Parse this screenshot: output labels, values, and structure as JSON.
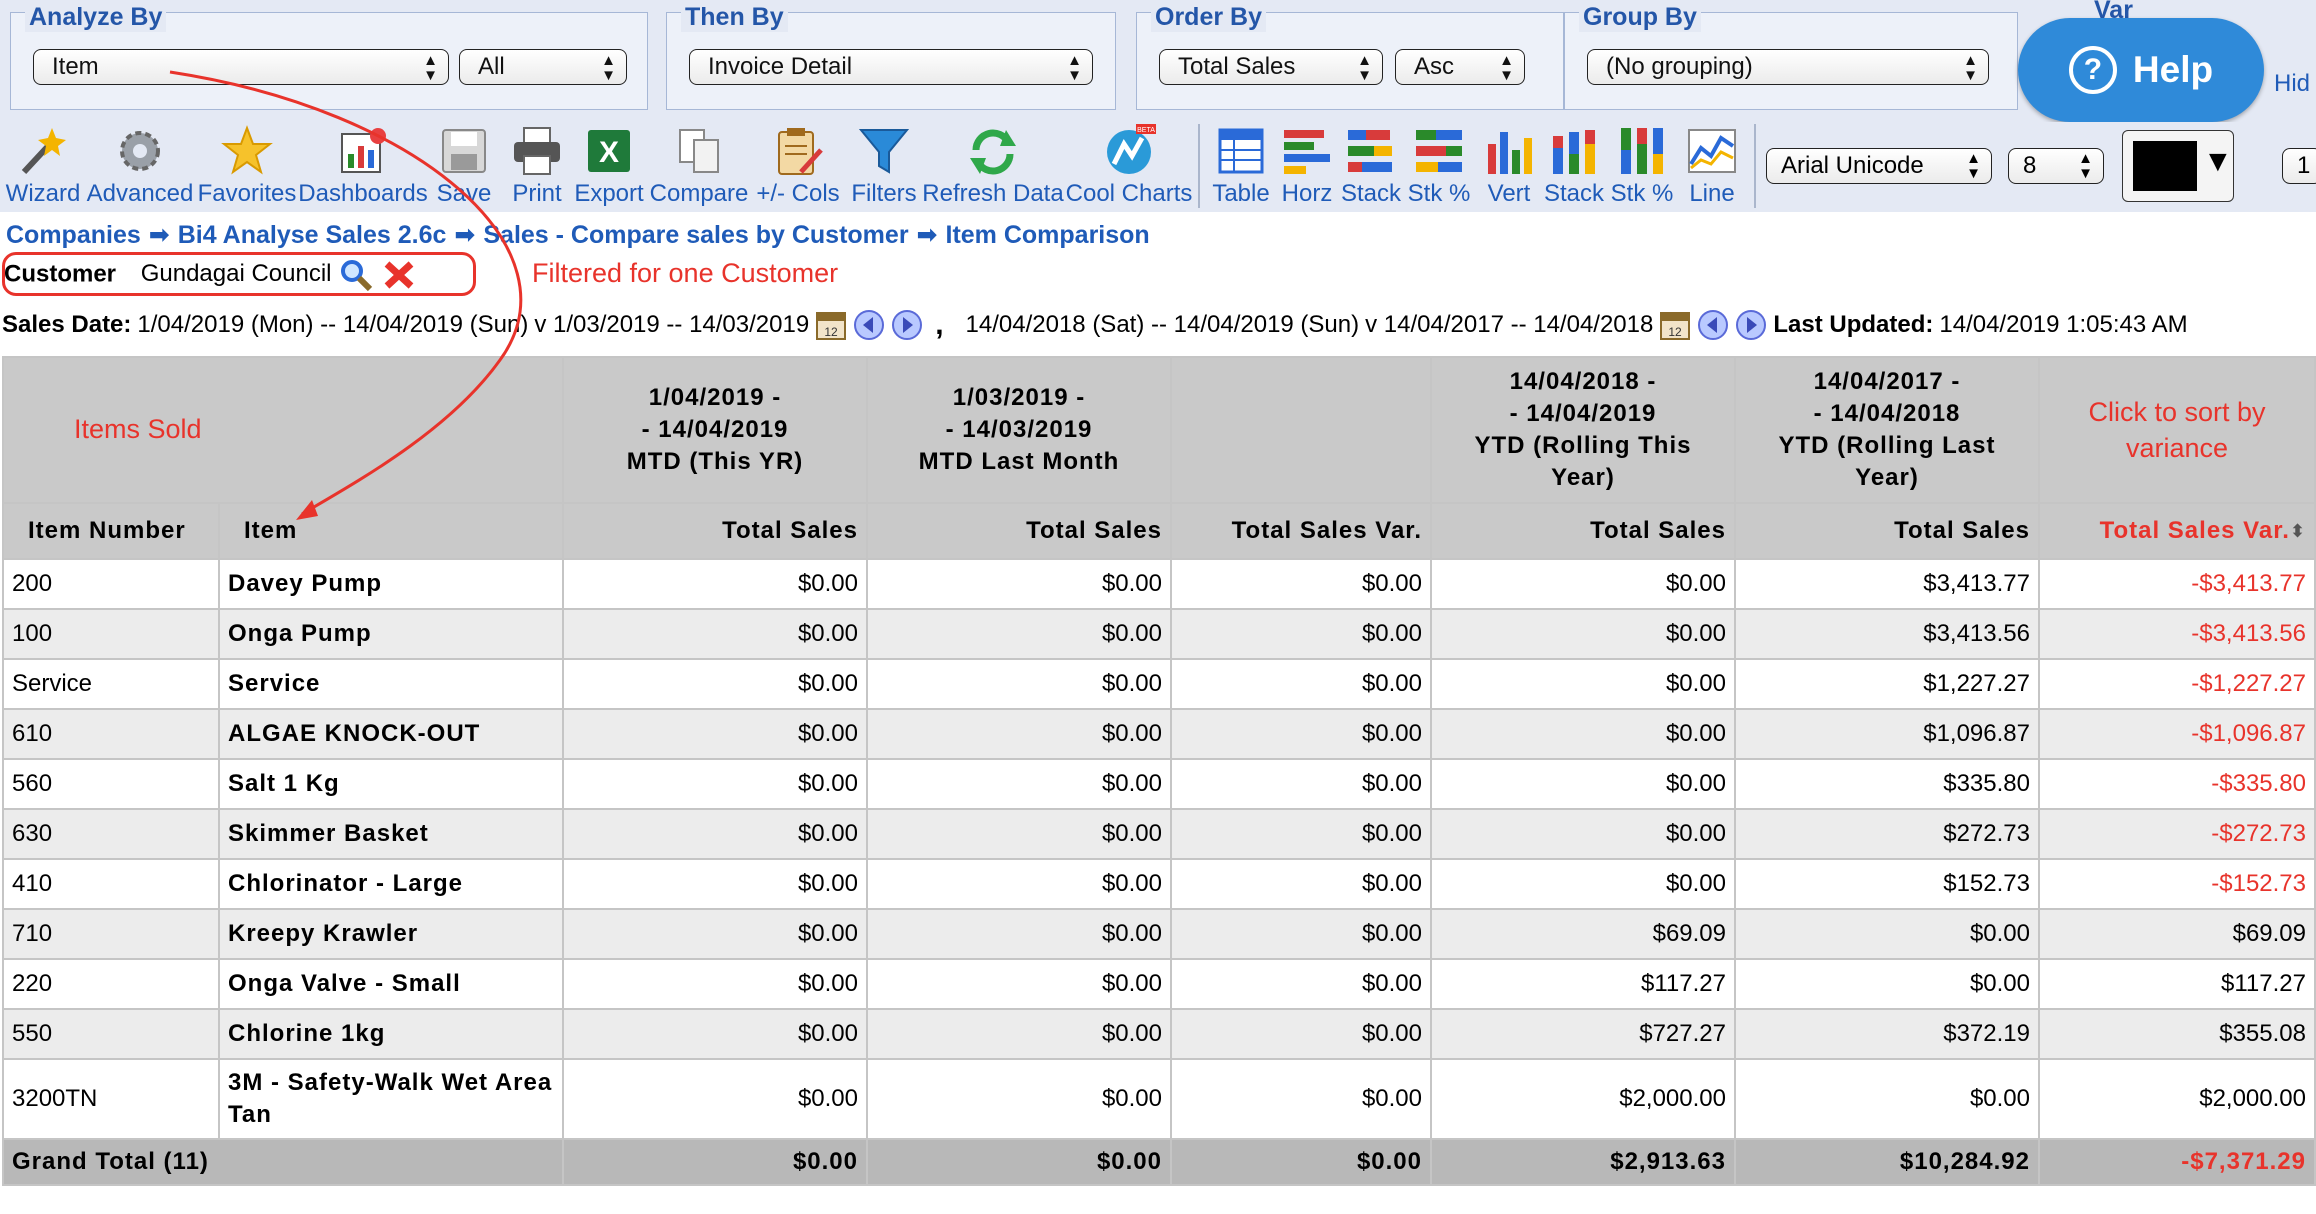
{
  "controls": {
    "analyze_by": {
      "title": "Analyze By",
      "value": "Item",
      "value2": "All"
    },
    "then_by": {
      "title": "Then By",
      "value": "Invoice Detail"
    },
    "order_by": {
      "title": "Order By",
      "value": "Total Sales",
      "direction": "Asc"
    },
    "group_by": {
      "title": "Group By",
      "value": "(No grouping)"
    },
    "var_title": "Var",
    "hide_label": "Hid",
    "help_label": "Help"
  },
  "toolbar": {
    "buttons": [
      "Wizard",
      "Advanced",
      "Favorites",
      "Dashboards",
      "Save",
      "Print",
      "Export",
      "Compare",
      "+/- Cols",
      "Filters",
      "Refresh Data",
      "Cool Charts"
    ],
    "chart_buttons": [
      "Table",
      "Horz",
      "Stack",
      "Stk %",
      "Vert",
      "Stack",
      "Stk %",
      "Line"
    ],
    "font_name": "Arial Unicode",
    "font_size": "8",
    "page_box": "1",
    "beta_badge": "BETA"
  },
  "breadcrumb": [
    "Companies",
    "Bi4 Analyse Sales 2.6c",
    "Sales - Compare sales by Customer",
    "Item Comparison"
  ],
  "filter": {
    "label": "Customer",
    "value": "Gundagai Council"
  },
  "annotations": {
    "filtered": "Filtered for one Customer",
    "items_sold": "Items Sold",
    "click_sort": "Click to sort by variance"
  },
  "dates": {
    "label": "Sales Date:",
    "range1": "1/04/2019 (Mon) -- 14/04/2019 (Sun)",
    "vs1": "v 1/03/2019 -- 14/03/2019",
    "comma": ",",
    "range2": "14/04/2018 (Sat) -- 14/04/2019 (Sun)",
    "vs2": "v 14/04/2017 -- 14/04/2018",
    "calendar_label": "12",
    "last_updated_label": "Last Updated:",
    "last_updated": "14/04/2019 1:05:43 AM"
  },
  "table": {
    "period_headers": [
      [
        "1/04/2019 -",
        "- 14/04/2019",
        "MTD (This YR)"
      ],
      [
        "1/03/2019 -",
        "- 14/03/2019",
        "MTD Last Month"
      ],
      [],
      [
        "14/04/2018 -",
        "- 14/04/2019",
        "YTD (Rolling This",
        "Year)"
      ],
      [
        "14/04/2017 -",
        "- 14/04/2018",
        "YTD (Rolling Last",
        "Year)"
      ]
    ],
    "columns": [
      "Item Number",
      "Item",
      "Total Sales",
      "Total Sales",
      "Total Sales Var.",
      "Total Sales",
      "Total Sales",
      "Total Sales Var."
    ],
    "rows": [
      {
        "num": "200",
        "item": "Davey Pump",
        "c1": "$0.00",
        "c2": "$0.00",
        "c3": "$0.00",
        "c4": "$0.00",
        "c5": "$3,413.77",
        "c6": "-$3,413.77"
      },
      {
        "num": "100",
        "item": "Onga Pump",
        "c1": "$0.00",
        "c2": "$0.00",
        "c3": "$0.00",
        "c4": "$0.00",
        "c5": "$3,413.56",
        "c6": "-$3,413.56"
      },
      {
        "num": "Service",
        "item": "Service",
        "c1": "$0.00",
        "c2": "$0.00",
        "c3": "$0.00",
        "c4": "$0.00",
        "c5": "$1,227.27",
        "c6": "-$1,227.27"
      },
      {
        "num": "610",
        "item": "ALGAE KNOCK-OUT",
        "c1": "$0.00",
        "c2": "$0.00",
        "c3": "$0.00",
        "c4": "$0.00",
        "c5": "$1,096.87",
        "c6": "-$1,096.87"
      },
      {
        "num": "560",
        "item": "Salt 1 Kg",
        "c1": "$0.00",
        "c2": "$0.00",
        "c3": "$0.00",
        "c4": "$0.00",
        "c5": "$335.80",
        "c6": "-$335.80"
      },
      {
        "num": "630",
        "item": "Skimmer Basket",
        "c1": "$0.00",
        "c2": "$0.00",
        "c3": "$0.00",
        "c4": "$0.00",
        "c5": "$272.73",
        "c6": "-$272.73"
      },
      {
        "num": "410",
        "item": "Chlorinator - Large",
        "c1": "$0.00",
        "c2": "$0.00",
        "c3": "$0.00",
        "c4": "$0.00",
        "c5": "$152.73",
        "c6": "-$152.73"
      },
      {
        "num": "710",
        "item": "Kreepy Krawler",
        "c1": "$0.00",
        "c2": "$0.00",
        "c3": "$0.00",
        "c4": "$69.09",
        "c5": "$0.00",
        "c6": "$69.09"
      },
      {
        "num": "220",
        "item": "Onga Valve - Small",
        "c1": "$0.00",
        "c2": "$0.00",
        "c3": "$0.00",
        "c4": "$117.27",
        "c5": "$0.00",
        "c6": "$117.27"
      },
      {
        "num": "550",
        "item": "Chlorine 1kg",
        "c1": "$0.00",
        "c2": "$0.00",
        "c3": "$0.00",
        "c4": "$727.27",
        "c5": "$372.19",
        "c6": "$355.08"
      },
      {
        "num": "3200TN",
        "item": "3M - Safety-Walk Wet Area Tan",
        "c1": "$0.00",
        "c2": "$0.00",
        "c3": "$0.00",
        "c4": "$2,000.00",
        "c5": "$0.00",
        "c6": "$2,000.00"
      }
    ],
    "total": {
      "label": "Grand Total (11)",
      "c1": "$0.00",
      "c2": "$0.00",
      "c3": "$0.00",
      "c4": "$2,913.63",
      "c5": "$10,284.92",
      "c6": "-$7,371.29"
    }
  },
  "colors": {
    "accent": "#1f5bb8",
    "negative": "#e8332b",
    "header_bg": "#c9c9c9",
    "help": "#2f8ad9"
  }
}
